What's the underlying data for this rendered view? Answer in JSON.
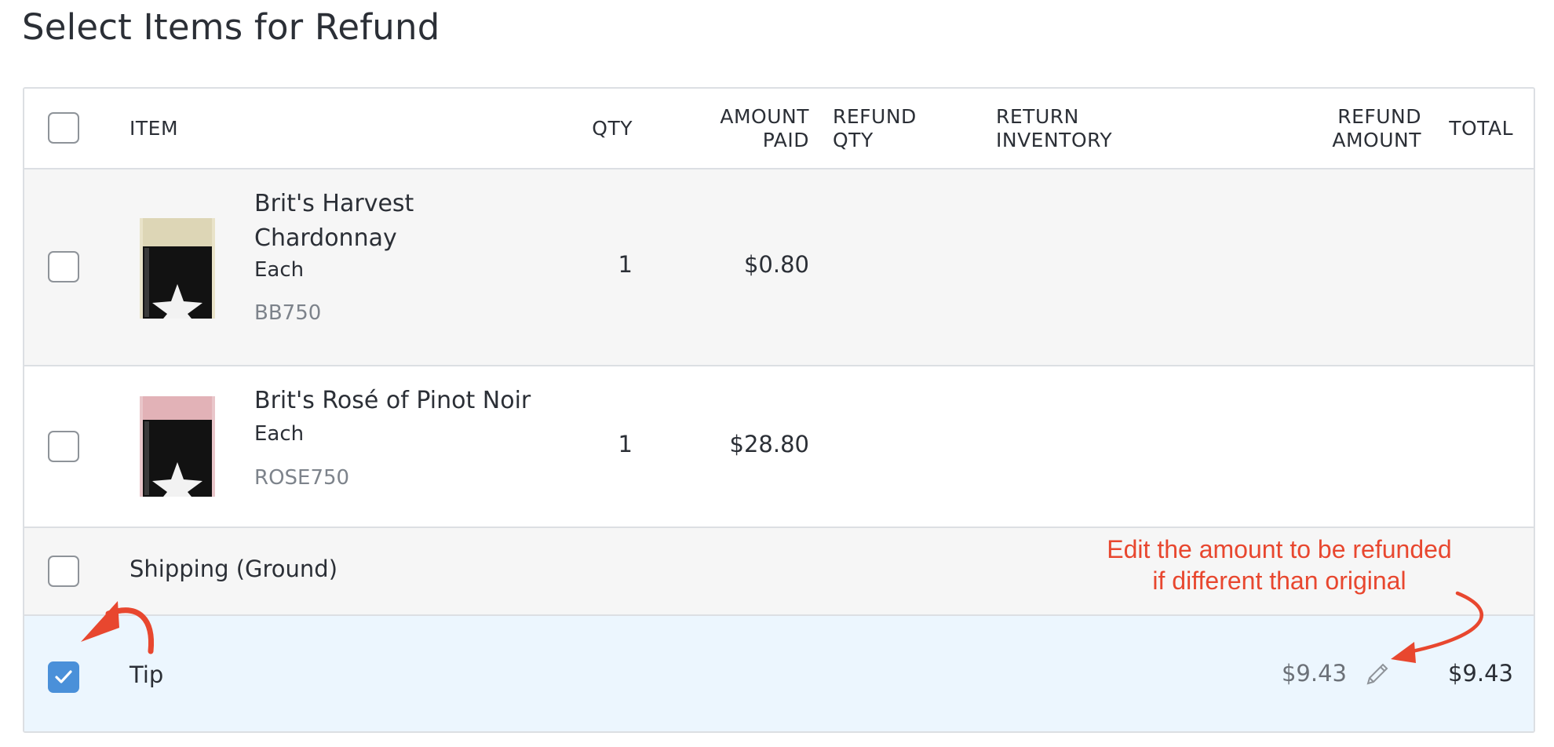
{
  "page": {
    "title": "Select Items for Refund"
  },
  "table": {
    "headers": {
      "item": "ITEM",
      "qty": "QTY",
      "amount_paid": "AMOUNT\nPAID",
      "refund_qty": "REFUND\nQTY",
      "return_inventory": "RETURN\nINVENTORY",
      "refund_amount": "REFUND\nAMOUNT",
      "total": "TOTAL"
    },
    "items": [
      {
        "name": "Brit's Harvest Chardonnay",
        "unit": "Each",
        "sku": "BB750",
        "qty": "1",
        "amount_paid": "$0.80",
        "selected": false,
        "thumbnail": "white-wine-bottle"
      },
      {
        "name": "Brit's Rosé of Pinot Noir",
        "unit": "Each",
        "sku": "ROSE750",
        "qty": "1",
        "amount_paid": "$28.80",
        "selected": false,
        "thumbnail": "rose-wine-bottle"
      }
    ],
    "shipping": {
      "label": "Shipping (Ground)",
      "selected": false
    },
    "tip": {
      "label": "Tip",
      "selected": true,
      "refund_amount": "$9.43",
      "total": "$9.43",
      "edit_icon": "pencil-icon"
    }
  },
  "annotation": {
    "text": "Edit the amount to be refunded\nif different than original"
  },
  "colors": {
    "accent": "#4a90d9",
    "annotation": "#e8472f",
    "selected_row": "#ecf6fe",
    "alt_row": "#f6f6f6",
    "border": "#dcdfe3"
  }
}
